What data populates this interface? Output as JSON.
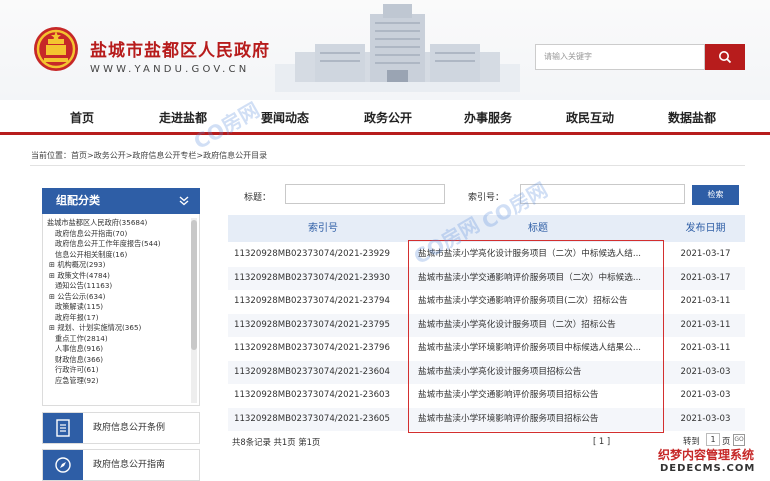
{
  "header": {
    "title": "盐城市盐都区人民政府",
    "domain": "WWW.YANDU.GOV.CN",
    "search_placeholder": "请输入关键字"
  },
  "nav": [
    "首页",
    "走进盐都",
    "要闻动态",
    "政务公开",
    "办事服务",
    "政民互动",
    "数据盐都"
  ],
  "breadcrumb": "当前位置：首页>政务公开>政府信息公开专栏>政府信息公开目录",
  "sidebar": {
    "header": "组配分类",
    "items": [
      "盐城市盐都区人民政府(35684)",
      "政府信息公开指南(70)",
      "政府信息公开工作年度报告(544)",
      "信息公开相关制度(16)",
      "机构概况(293)",
      "政策文件(4784)",
      "通知公告(11163)",
      "公告公示(634)",
      "政策解读(115)",
      "政府年报(17)",
      "规划、计划实施情况(365)",
      "重点工作(2814)",
      "人事信息(916)",
      "财政信息(366)",
      "行政许可(61)",
      "应急管理(92)"
    ],
    "quick_links": [
      "政府信息公开条例",
      "政府信息公开指南"
    ]
  },
  "filter": {
    "title_label": "标题：",
    "index_label": "索引号：",
    "search_button": "检索"
  },
  "table": {
    "headers": [
      "索引号",
      "标题",
      "发布日期"
    ],
    "rows": [
      {
        "id": "11320928MB02373074/2021-23929",
        "title": "盐城市盐渎小学亮化设计服务项目（二次）中标候选人结...",
        "date": "2021-03-17"
      },
      {
        "id": "11320928MB02373074/2021-23930",
        "title": "盐城市盐渎小学交通影响评价服务项目（二次）中标候选...",
        "date": "2021-03-17"
      },
      {
        "id": "11320928MB02373074/2021-23794",
        "title": "盐城市盐渎小学交通影响评价服务项目(二次）招标公告",
        "date": "2021-03-11"
      },
      {
        "id": "11320928MB02373074/2021-23795",
        "title": "盐城市盐渎小学亮化设计服务项目（二次）招标公告",
        "date": "2021-03-11"
      },
      {
        "id": "11320928MB02373074/2021-23796",
        "title": "盐城市盐渎小学环境影响评价服务项目中标候选人结果公...",
        "date": "2021-03-11"
      },
      {
        "id": "11320928MB02373074/2021-23604",
        "title": "盐城市盐渎小学亮化设计服务项目招标公告",
        "date": "2021-03-03"
      },
      {
        "id": "11320928MB02373074/2021-23603",
        "title": "盐城市盐渎小学交通影响评价服务项目招标公告",
        "date": "2021-03-03"
      },
      {
        "id": "11320928MB02373074/2021-23605",
        "title": "盐城市盐渎小学环境影响评价服务项目招标公告",
        "date": "2021-03-03"
      }
    ]
  },
  "pagination": {
    "summary": "共8条记录  共1页  第1页",
    "pages": "[ 1 ]",
    "goto_label": "转到",
    "goto_value": "1",
    "page_suffix": "页",
    "go": "GO"
  },
  "watermark": "CO房网",
  "branding": {
    "line1": "织梦内容管理系统",
    "line2": "DEDECMS.COM"
  },
  "colors": {
    "brand_red": "#b71c1c",
    "brand_blue": "#2e5ea6",
    "highlight_red": "#d32f2f"
  }
}
